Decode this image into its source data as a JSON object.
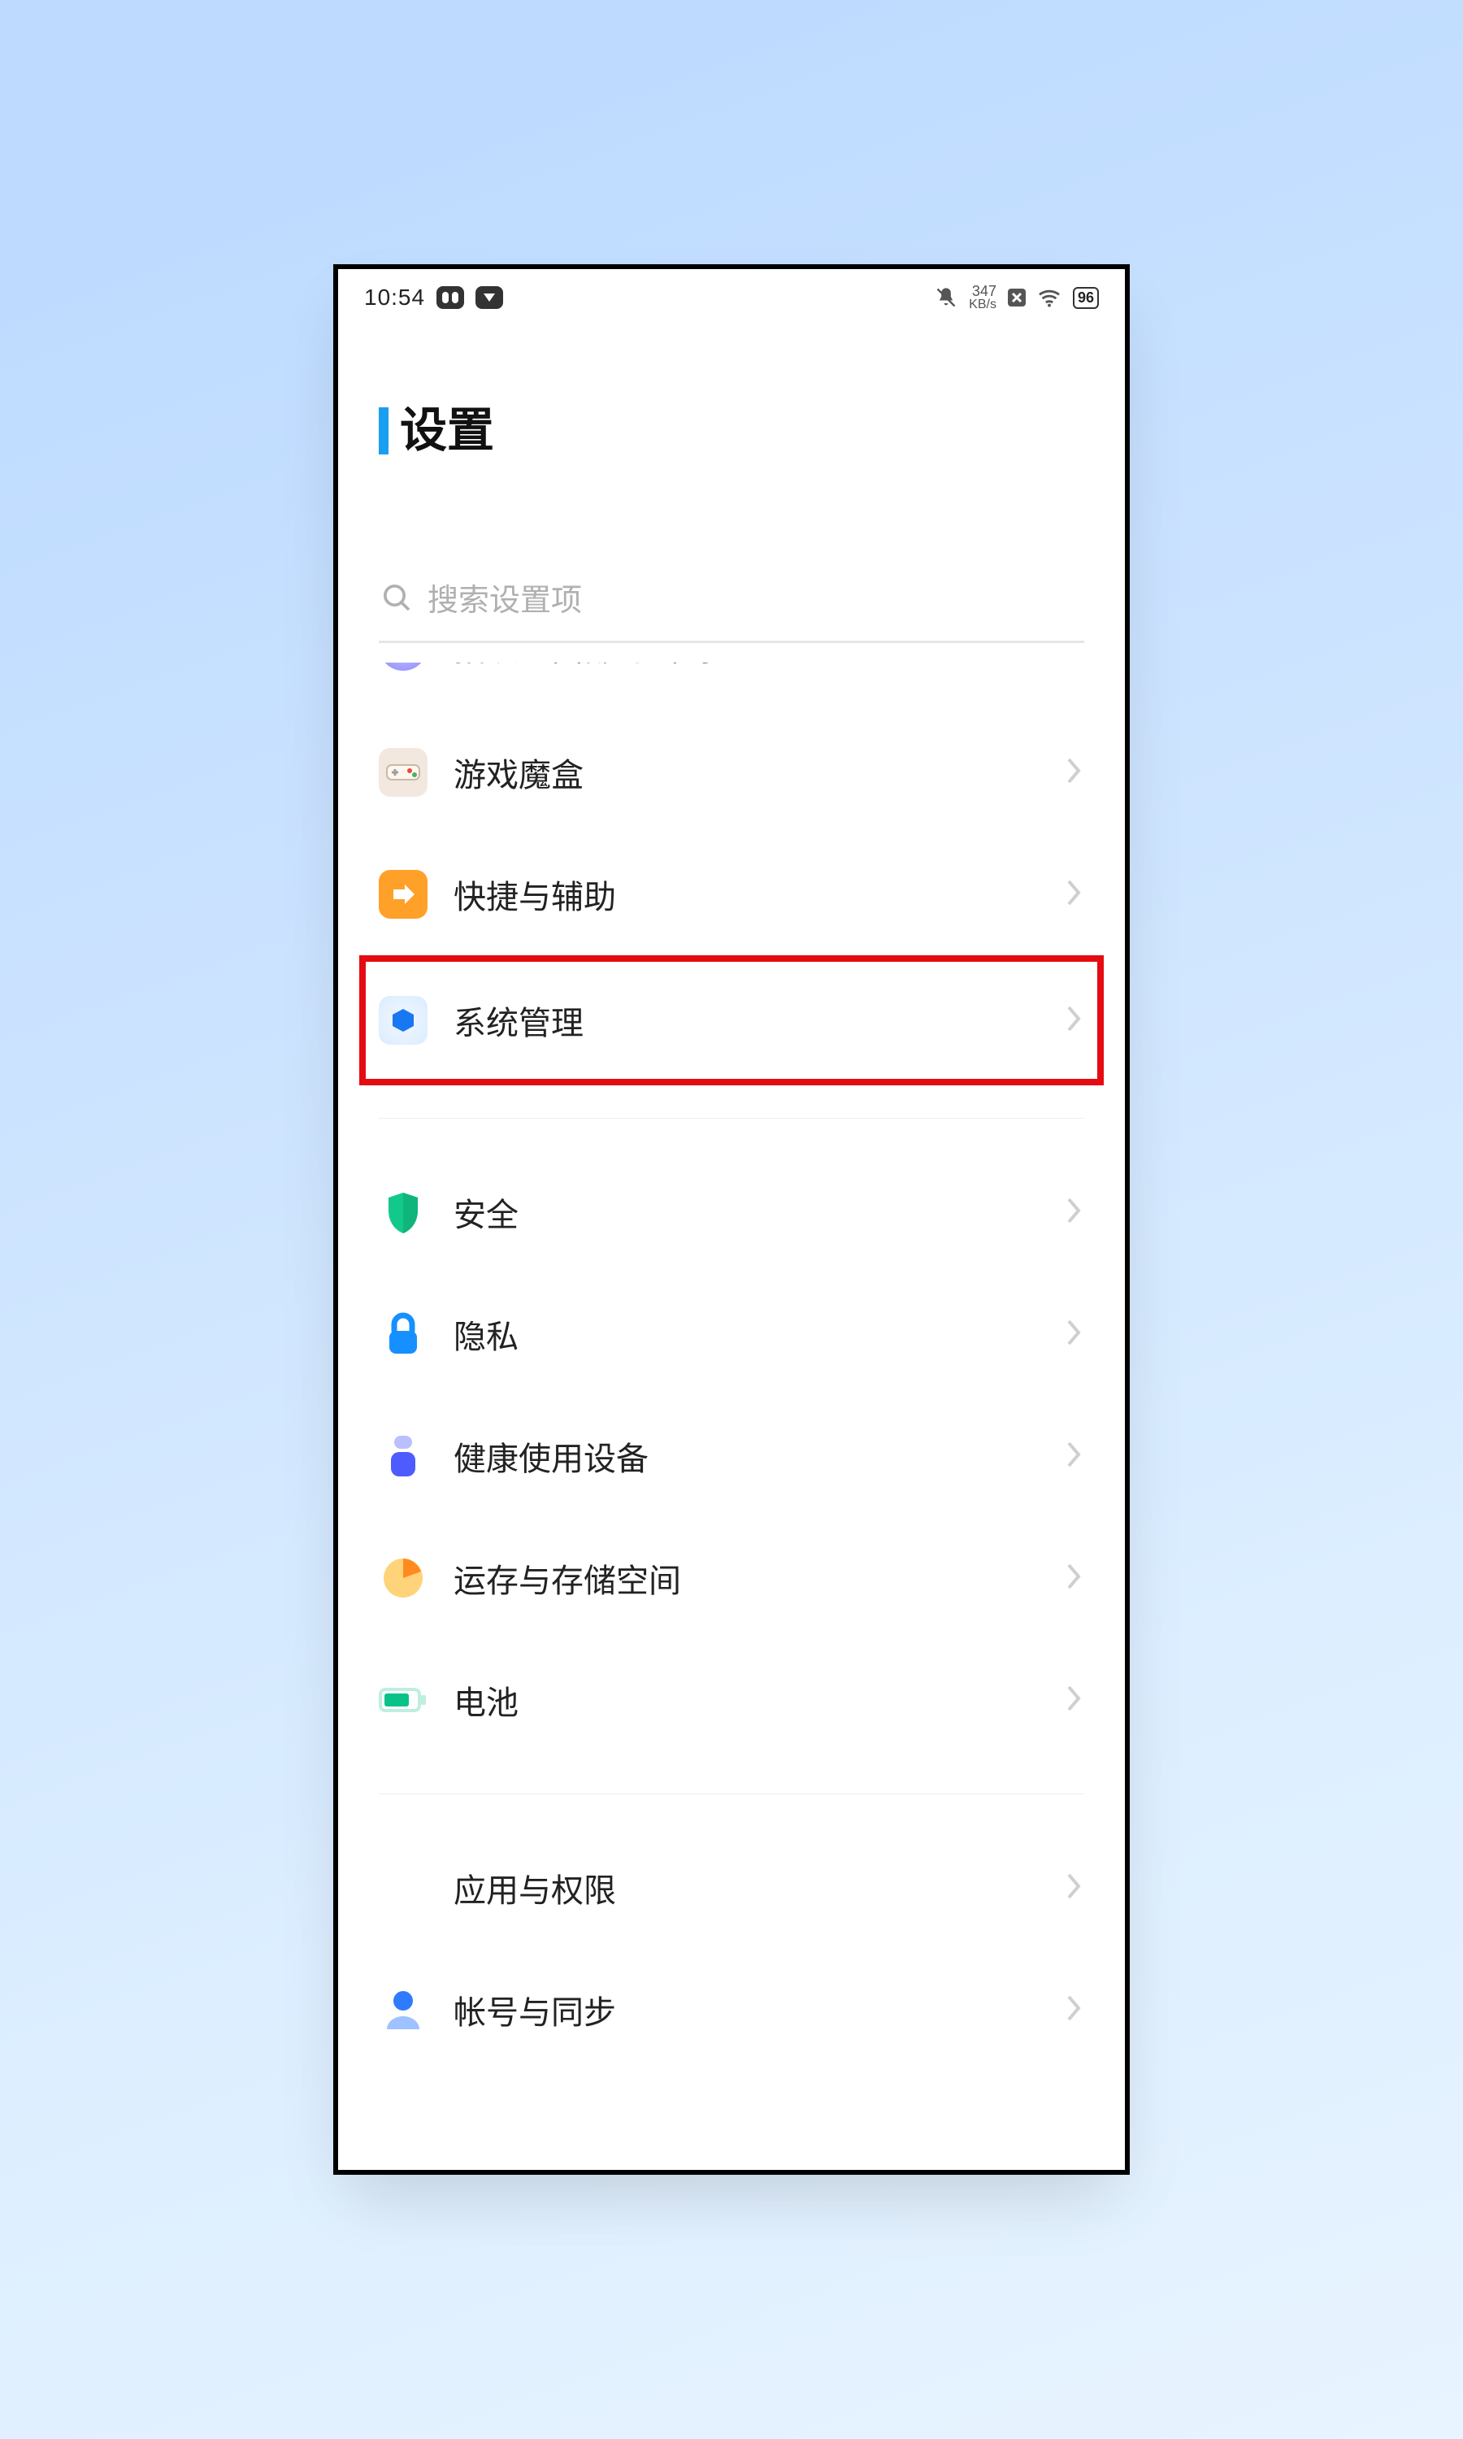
{
  "status": {
    "time": "10:54",
    "net_speed_value": "347",
    "net_speed_unit": "KB/s",
    "battery": "96"
  },
  "title": "设置",
  "search": {
    "placeholder": "搜索设置项"
  },
  "rows": {
    "fingerprint_label": "指纹、面部与密码",
    "gamebox_label": "游戏魔盒",
    "shortcut_label": "快捷与辅助",
    "system_label": "系统管理",
    "security_label": "安全",
    "privacy_label": "隐私",
    "health_label": "健康使用设备",
    "storage_label": "运存与存储空间",
    "battery_label": "电池",
    "apps_label": "应用与权限",
    "account_label": "帐号与同步"
  }
}
